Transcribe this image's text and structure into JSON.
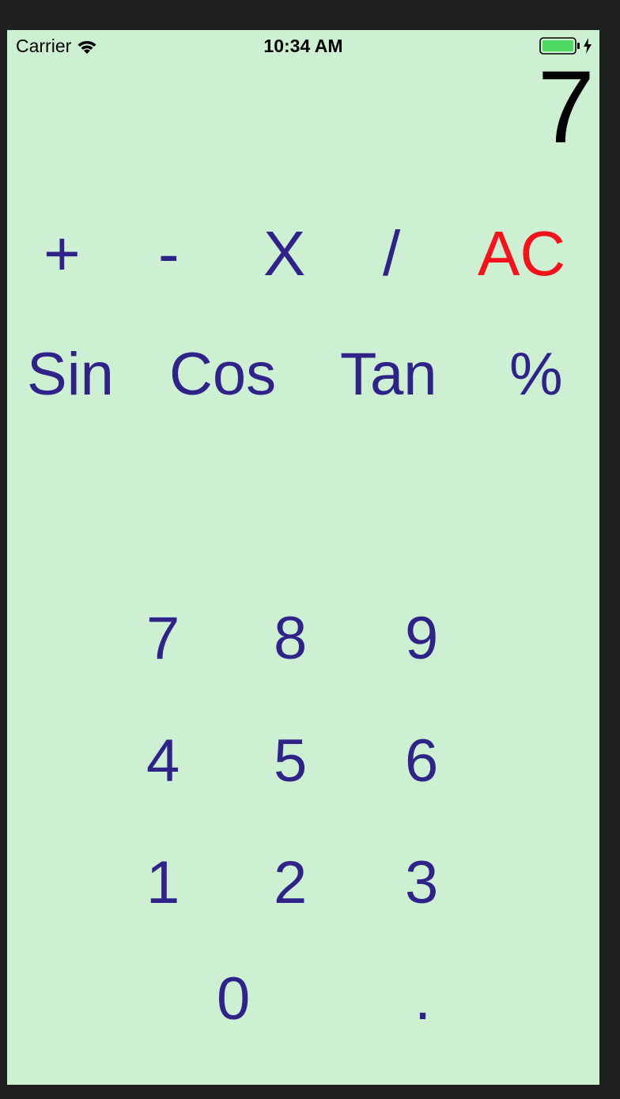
{
  "status_bar": {
    "carrier": "Carrier",
    "time": "10:34 AM",
    "wifi_icon": "wifi-icon",
    "battery_icon": "battery-icon",
    "charging_icon": "charging-bolt-icon"
  },
  "display": {
    "value": "7"
  },
  "operators": {
    "plus": "+",
    "minus": "-",
    "multiply": "X",
    "divide": "/",
    "clear": "AC"
  },
  "functions": {
    "sin": "Sin",
    "cos": "Cos",
    "tan": "Tan",
    "percent": "%"
  },
  "digits": {
    "seven": "7",
    "eight": "8",
    "nine": "9",
    "four": "4",
    "five": "5",
    "six": "6",
    "one": "1",
    "two": "2",
    "three": "3",
    "zero": "0",
    "decimal": "."
  },
  "colors": {
    "background": "#cdf0d3",
    "button_text": "#2f2288",
    "clear_text": "#f4121d",
    "display_text": "#000000",
    "battery_fill": "#4cd964"
  }
}
